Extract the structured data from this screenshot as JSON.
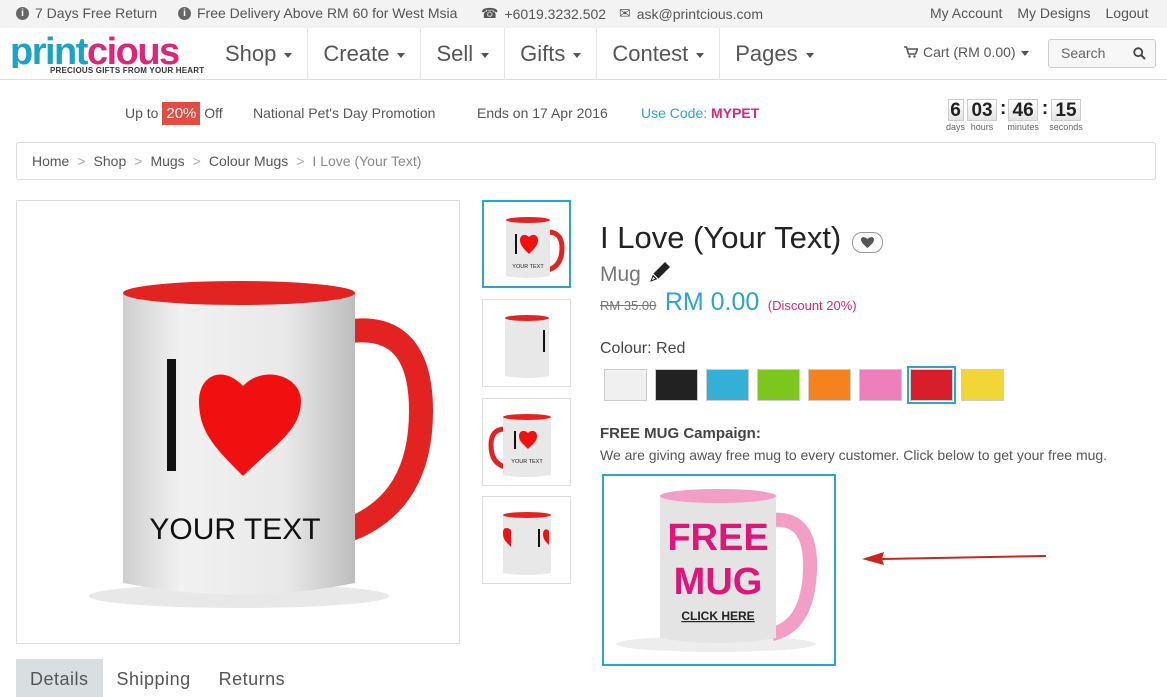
{
  "topbar": {
    "return": "7 Days Free Return",
    "delivery": "Free Delivery Above RM 60 for West Msia",
    "phone": "+6019.3232.502",
    "email": "ask@printcious.com",
    "my_account": "My Account",
    "my_designs": "My Designs",
    "logout": "Logout"
  },
  "brand": {
    "logo": "printcious",
    "tagline": "PRECIOUS GIFTS FROM YOUR HEART",
    "primary_color": "#1aa3c9",
    "accent_color": "#e0247a"
  },
  "menu": [
    "Shop",
    "Create",
    "Sell",
    "Gifts",
    "Contest",
    "Pages"
  ],
  "cart_label": "Cart (RM 0.00)",
  "search_label": "Search",
  "promo": {
    "upto": "Up to",
    "percent": "20%",
    "off": "Off",
    "name": "National Pet's Day Promotion",
    "ends": "Ends on 17 Apr 2016",
    "code_label": "Use Code:",
    "code": "MYPET"
  },
  "countdown": {
    "days": "6",
    "hours": "03",
    "minutes": "46",
    "seconds": "15",
    "days_label": "days",
    "hours_label": "hours",
    "minutes_label": "minutes",
    "seconds_label": "seconds"
  },
  "breadcrumb": [
    "Home",
    "Shop",
    "Mugs",
    "Colour Mugs",
    "I Love (Your Text)"
  ],
  "product": {
    "title": "I Love (Your Text)",
    "type": "Mug",
    "old_price": "RM 35.00",
    "price": "RM 0.00",
    "discount": "(Discount 20%)",
    "mug_text": "YOUR TEXT",
    "colour_label": "Colour: Red",
    "colours": [
      "#f0f0f0",
      "#222222",
      "#34b0d6",
      "#7dc61e",
      "#f5821f",
      "#ec7fbc",
      "#d71e2b",
      "#f2d536"
    ],
    "selected_colour": 6
  },
  "free_mug": {
    "title": "FREE MUG Campaign:",
    "desc": "We are giving away free mug to every customer. Click below to get your free mug.",
    "line1": "FREE",
    "line2": "MUG",
    "cta": "CLICK HERE"
  },
  "tabs": [
    "Details",
    "Shipping",
    "Returns"
  ]
}
